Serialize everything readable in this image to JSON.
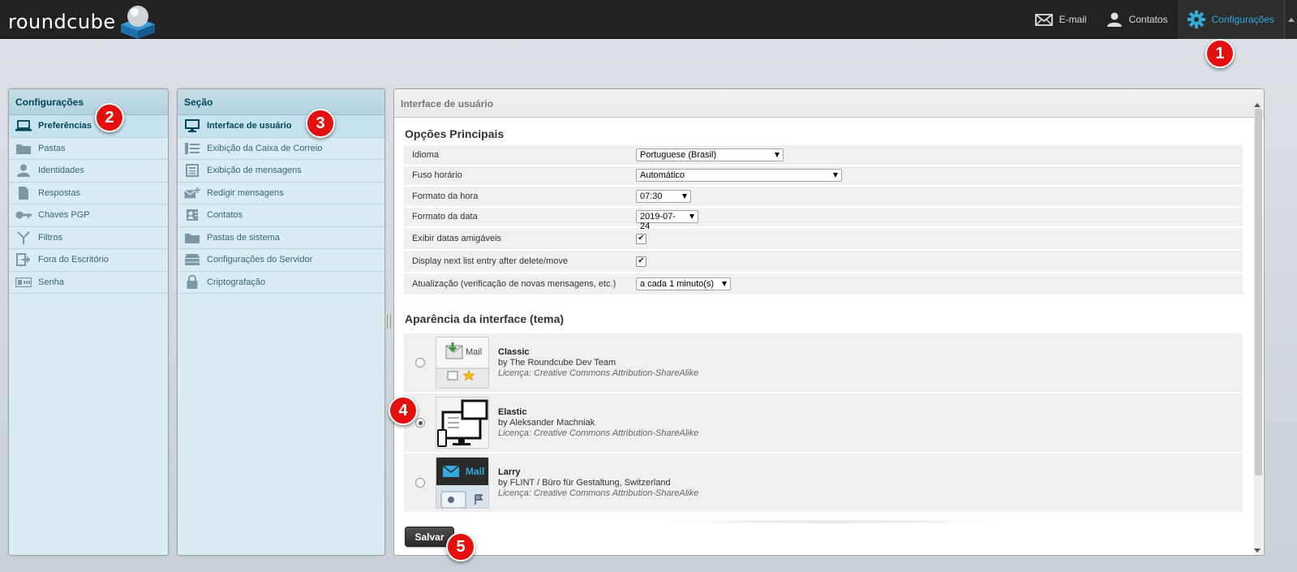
{
  "app": {
    "logo_text": "roundcube"
  },
  "topnav": {
    "items": [
      {
        "label": "E-mail",
        "icon": "envelope-icon"
      },
      {
        "label": "Contatos",
        "icon": "user-icon"
      },
      {
        "label": "Configurações",
        "icon": "gear-icon",
        "active": true
      }
    ],
    "accent_color": "#33a9dc"
  },
  "badges": [
    "1",
    "2",
    "3",
    "4",
    "5"
  ],
  "settings_panel": {
    "title": "Configurações",
    "items": [
      {
        "label": "Preferências",
        "icon": "laptop-icon"
      },
      {
        "label": "Pastas",
        "icon": "folder-icon"
      },
      {
        "label": "Identidades",
        "icon": "identity-icon"
      },
      {
        "label": "Respostas",
        "icon": "document-icon"
      },
      {
        "label": "Chaves PGP",
        "icon": "key-icon"
      },
      {
        "label": "Filtros",
        "icon": "filter-icon"
      },
      {
        "label": "Fora do Escritório",
        "icon": "out-of-office-icon"
      },
      {
        "label": "Senha",
        "icon": "password-icon"
      }
    ]
  },
  "section_panel": {
    "title": "Seção",
    "items": [
      {
        "label": "Interface de usuário",
        "icon": "monitor-icon"
      },
      {
        "label": "Exibição da Caixa de Correio",
        "icon": "mailbox-view-icon"
      },
      {
        "label": "Exibição de mensagens",
        "icon": "message-view-icon"
      },
      {
        "label": "Redigir mensagens",
        "icon": "compose-icon"
      },
      {
        "label": "Contatos",
        "icon": "contacts-icon"
      },
      {
        "label": "Pastas de sistema",
        "icon": "system-folder-icon"
      },
      {
        "label": "Configurações do Servidor",
        "icon": "server-icon"
      },
      {
        "label": "Criptografação",
        "icon": "lock-icon"
      }
    ]
  },
  "main": {
    "header": "Interface de usuário",
    "main_options_title": "Opções Principais",
    "options": {
      "idioma": {
        "label": "Idioma",
        "value": "Portuguese (Brasil)"
      },
      "fuso": {
        "label": "Fuso horário",
        "value": "Automático"
      },
      "hora": {
        "label": "Formato da hora",
        "value": "07:30"
      },
      "data": {
        "label": "Formato da data",
        "value": "2019-07-24"
      },
      "amigaveis": {
        "label": "Exibir datas amigáveis",
        "checked": true
      },
      "next": {
        "label": "Display next list entry after delete/move",
        "checked": true
      },
      "refresh": {
        "label": "Atualização (verificação de novas mensagens, etc.)",
        "value": "a cada 1 minuto(s)"
      }
    },
    "skins_title": "Aparência da interface (tema)",
    "skins": [
      {
        "name": "Classic",
        "author": "by The Roundcube Dev Team",
        "license": "Licença: Creative Commons Attribution-ShareAlike",
        "selected": false,
        "thumb_label": "Mail"
      },
      {
        "name": "Elastic",
        "author": "by Aleksander Machniak",
        "license": "Licença: Creative Commons Attribution-ShareAlike",
        "selected": true
      },
      {
        "name": "Larry",
        "author": "by FLINT / Büro für Gestaltung, Switzerland",
        "license": "Licença: Creative Commons Attribution-ShareAlike",
        "selected": false,
        "thumb_label": "Mail"
      }
    ],
    "save_label": "Salvar"
  }
}
